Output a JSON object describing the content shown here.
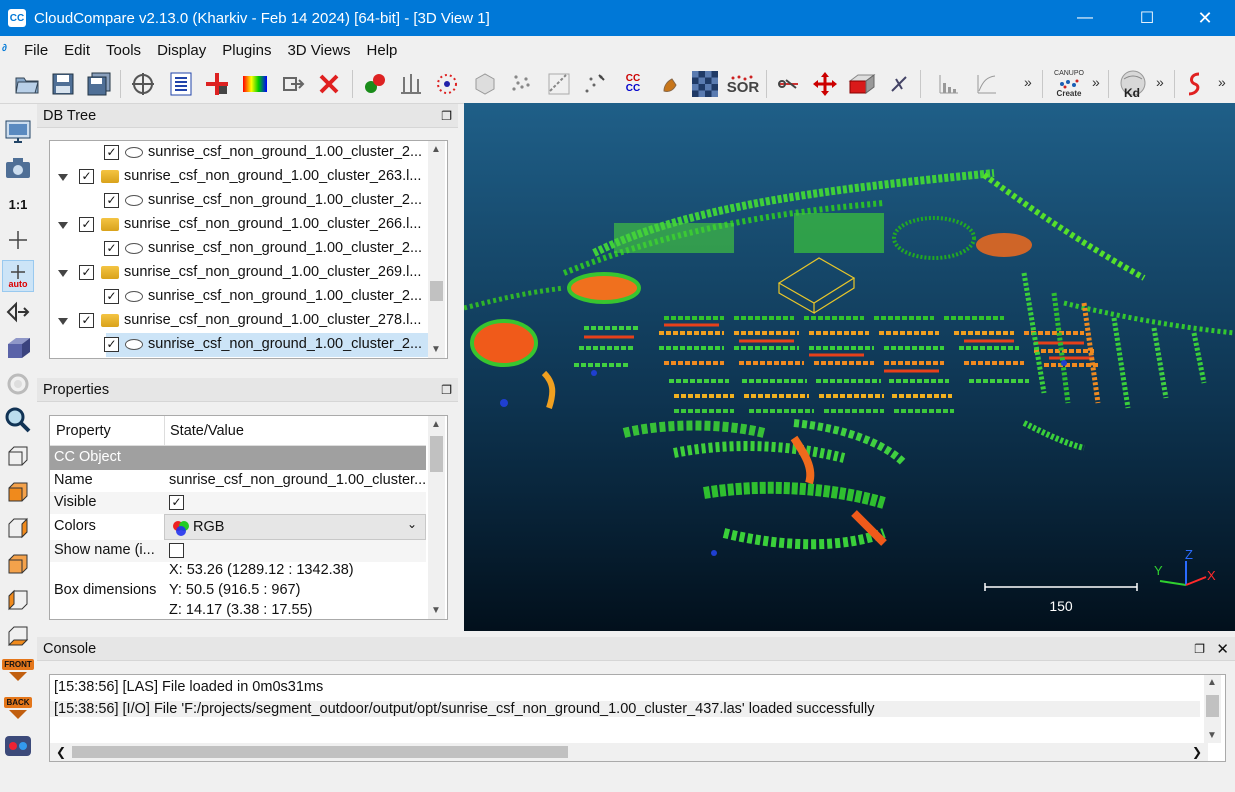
{
  "window": {
    "title": "CloudCompare v2.13.0 (Kharkiv - Feb 14 2024) [64-bit] - [3D View 1]",
    "app_icon": "CC"
  },
  "menu": [
    "File",
    "Edit",
    "Tools",
    "Display",
    "Plugins",
    "3D Views",
    "Help"
  ],
  "toolbar": {
    "sor_label": "SOR",
    "canupo_label_1": "CANUPO",
    "canupo_label_2": "Create",
    "kd_label": "Kd",
    "cc_label_1": "CC",
    "cc_label_2": "CC",
    "chevron": "»"
  },
  "left_toolbar": {
    "one_to_one": "1:1",
    "auto_label": "auto",
    "front_label": "FRONT",
    "back_label": "BACK"
  },
  "db_tree": {
    "title": "DB Tree",
    "rows": [
      {
        "label": "sunrise_csf_non_ground_1.00_cluster_2...",
        "kind": "cloud",
        "checked": true,
        "level": 2
      },
      {
        "label": "sunrise_csf_non_ground_1.00_cluster_263.l...",
        "kind": "folder",
        "checked": true,
        "level": 1
      },
      {
        "label": "sunrise_csf_non_ground_1.00_cluster_2...",
        "kind": "cloud",
        "checked": true,
        "level": 2
      },
      {
        "label": "sunrise_csf_non_ground_1.00_cluster_266.l...",
        "kind": "folder",
        "checked": true,
        "level": 1
      },
      {
        "label": "sunrise_csf_non_ground_1.00_cluster_2...",
        "kind": "cloud",
        "checked": true,
        "level": 2
      },
      {
        "label": "sunrise_csf_non_ground_1.00_cluster_269.l...",
        "kind": "folder",
        "checked": true,
        "level": 1
      },
      {
        "label": "sunrise_csf_non_ground_1.00_cluster_2...",
        "kind": "cloud",
        "checked": true,
        "level": 2
      },
      {
        "label": "sunrise_csf_non_ground_1.00_cluster_278.l...",
        "kind": "folder",
        "checked": true,
        "level": 1
      },
      {
        "label": "sunrise_csf_non_ground_1.00_cluster_2...",
        "kind": "cloud",
        "checked": true,
        "level": 2,
        "selected": true
      }
    ]
  },
  "properties": {
    "title": "Properties",
    "col_property": "Property",
    "col_value": "State/Value",
    "section": "CC Object",
    "name_key": "Name",
    "name_value": "sunrise_csf_non_ground_1.00_cluster...",
    "visible_key": "Visible",
    "colors_key": "Colors",
    "colors_value": "RGB",
    "show_name_key": "Show name (i...",
    "box_key": "Box dimensions",
    "box_x": "X: 53.26 (1289.12 : 1342.38)",
    "box_y": "Y: 50.5 (916.5 : 967)",
    "box_z": "Z: 14.17 (3.38 : 17.55)"
  },
  "view3d": {
    "scale_label": "150",
    "axis_x": "X",
    "axis_y": "Y",
    "axis_z": "Z"
  },
  "console": {
    "title": "Console",
    "lines": [
      "[15:38:56] [LAS] File loaded in 0m0s31ms",
      "[15:38:56] [I/O] File 'F:/projects/segment_outdoor/output/opt/sunrise_csf_non_ground_1.00_cluster_437.las' loaded successfully"
    ]
  },
  "colors": {
    "title_bar": "#0078d7",
    "selection": "#cce4f7",
    "section_header": "#a0a0a0"
  }
}
